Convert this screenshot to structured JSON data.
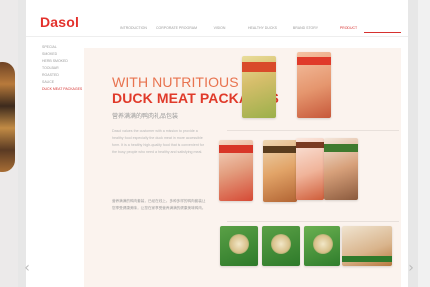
{
  "site": {
    "logo": "Dasol",
    "nav": [
      {
        "label": "INTRODUCTION",
        "active": false
      },
      {
        "label": "CORPORATE PROGRAM",
        "active": false
      },
      {
        "label": "VISION",
        "active": false
      },
      {
        "label": "HEALTHY DUCKS",
        "active": false
      },
      {
        "label": "BRAND STORY",
        "active": false
      },
      {
        "label": "PRODUCT",
        "active": true
      }
    ],
    "sidebar": [
      {
        "label": "SPECIAL",
        "active": false
      },
      {
        "label": "SMOKED",
        "active": false
      },
      {
        "label": "HERB SMOKED",
        "active": false
      },
      {
        "label": "TOOLBAR",
        "active": false
      },
      {
        "label": "ROASTED",
        "active": false
      },
      {
        "label": "SAUCE",
        "active": false
      },
      {
        "label": "DUCK MEAT PACKAGES",
        "active": true
      }
    ]
  },
  "content": {
    "headline_line1": "WITH NUTRITIOUS",
    "headline_line2": "DUCK MEAT PACKAGES",
    "chinese_title": "营养满满的鸭肉礼品包装",
    "paragraph_en": "Dasol values the customer with a mission to provide a healthy food especially the duck meat in more accessible form. It is a healthy high-quality food that is convenient for the busy people who need a healthy and satisfying meal.",
    "paragraph_cn": "营养满满的鸭肉套装，已经在线上。多种多样的鸭肉套装让您享受健康美味，让您在家享受营养满满的健康美味鸭肉。"
  },
  "colors": {
    "brand_red": "#e3312c",
    "accent_orange": "#e8734f",
    "content_bg": "#fbf3ee"
  },
  "icons": {
    "prev": "chevron-left-icon",
    "next": "chevron-right-icon"
  }
}
